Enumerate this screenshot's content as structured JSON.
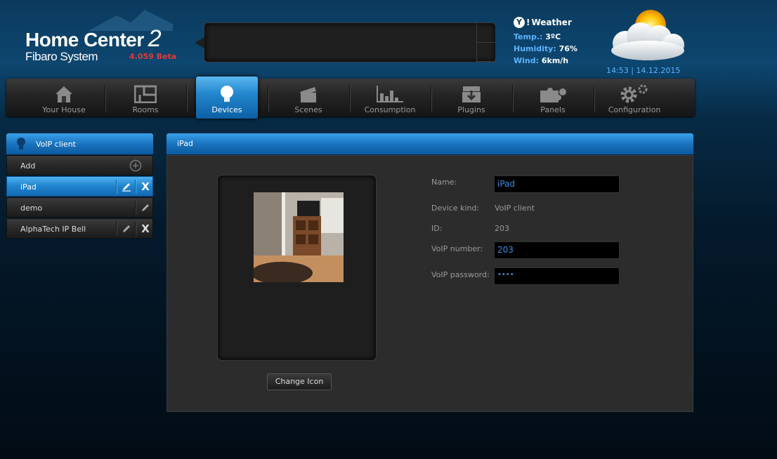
{
  "header": {
    "logo_title": "Home Center",
    "logo_number": "2",
    "logo_subtitle": "Fibaro System",
    "version": "4.059 Beta"
  },
  "weather": {
    "brand": "Weather",
    "temp_label": "Temp.:",
    "temp_value": "3ºC",
    "humidity_label": "Humidity:",
    "humidity_value": "76%",
    "wind_label": "Wind:",
    "wind_value": "6km/h",
    "datetime": "14:53 | 14.12.2015",
    "condition_icon": "partly-cloudy-icon"
  },
  "nav": {
    "items": [
      {
        "label": "Your House",
        "icon": "house-icon"
      },
      {
        "label": "Rooms",
        "icon": "rooms-icon"
      },
      {
        "label": "Devices",
        "icon": "bulb-icon",
        "active": true
      },
      {
        "label": "Scenes",
        "icon": "clapperboard-icon"
      },
      {
        "label": "Consumption",
        "icon": "chart-icon"
      },
      {
        "label": "Plugins",
        "icon": "download-box-icon"
      },
      {
        "label": "Panels",
        "icon": "puzzle-icon"
      },
      {
        "label": "Configuration",
        "icon": "gears-icon"
      }
    ]
  },
  "sidebar": {
    "title": "VoIP client",
    "add_label": "Add",
    "items": [
      {
        "label": "iPad",
        "active": true
      },
      {
        "label": "demo"
      },
      {
        "label": "AlphaTech IP Bell"
      }
    ]
  },
  "main": {
    "title": "iPad",
    "change_icon_label": "Change Icon",
    "name_label": "Name:",
    "name_value": "iPad",
    "kind_label": "Device kind:",
    "kind_value": "VoIP client",
    "id_label": "ID:",
    "id_value": "203",
    "number_label": "VoIP number:",
    "number_value": "203",
    "password_label": "VoIP password:",
    "password_value": "••••"
  },
  "colors": {
    "accent_blue": "#1f83cf",
    "link_blue": "#5ab4ff",
    "version_red": "#e03a3a"
  }
}
